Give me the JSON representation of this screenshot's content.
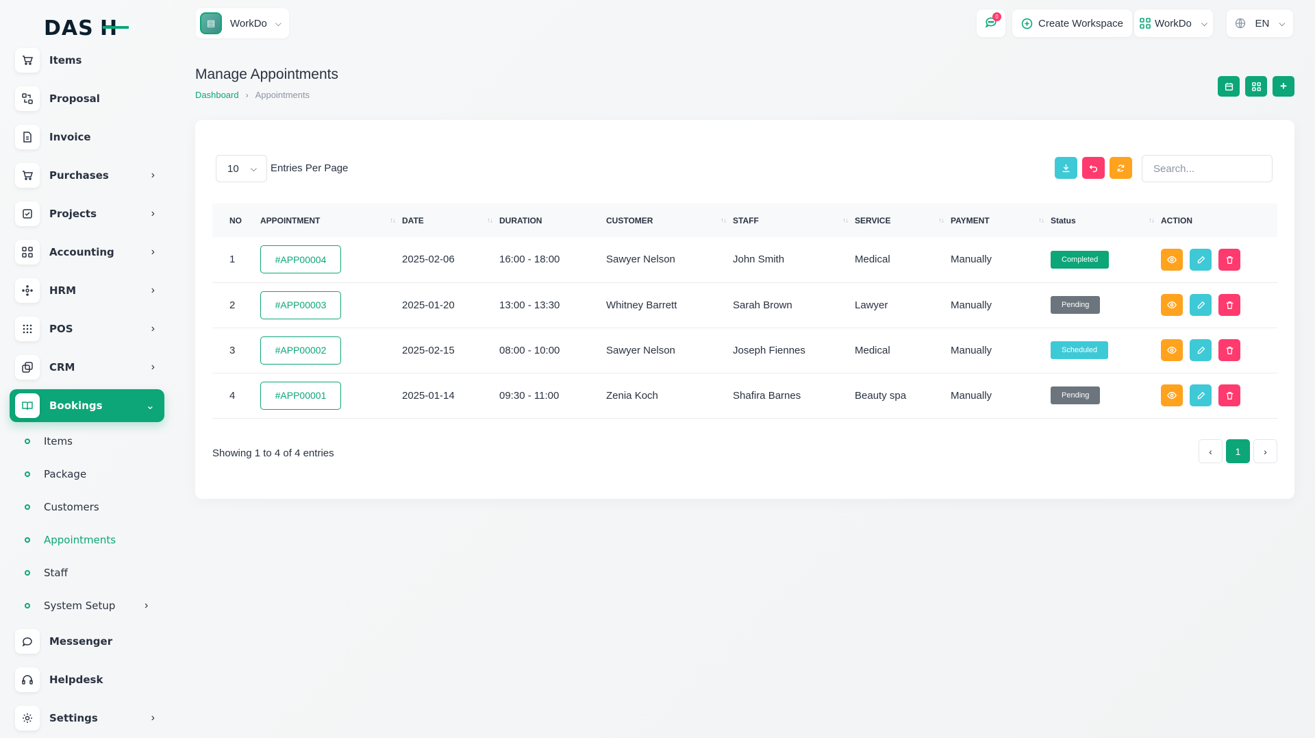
{
  "brand": {
    "logo_left": "DAS",
    "logo_right": "H"
  },
  "sidebar": {
    "items": [
      {
        "label": "Items",
        "icon": "cart-icon"
      },
      {
        "label": "Proposal",
        "icon": "proposal-icon"
      },
      {
        "label": "Invoice",
        "icon": "invoice-icon"
      },
      {
        "label": "Purchases",
        "icon": "cart-icon"
      },
      {
        "label": "Projects",
        "icon": "check-square-icon"
      },
      {
        "label": "Accounting",
        "icon": "grid-icon"
      },
      {
        "label": "HRM",
        "icon": "users-icon"
      },
      {
        "label": "POS",
        "icon": "dots-grid-icon"
      },
      {
        "label": "CRM",
        "icon": "layers-icon"
      },
      {
        "label": "Bookings",
        "icon": "book-icon"
      },
      {
        "label": "Messenger",
        "icon": "chat-icon"
      },
      {
        "label": "Helpdesk",
        "icon": "headset-icon"
      },
      {
        "label": "Settings",
        "icon": "gear-icon"
      }
    ],
    "bookings_sub": [
      {
        "label": "Items"
      },
      {
        "label": "Package"
      },
      {
        "label": "Customers"
      },
      {
        "label": "Appointments"
      },
      {
        "label": "Staff"
      },
      {
        "label": "System Setup"
      }
    ],
    "active_color": "#0ca678"
  },
  "header": {
    "workspace": "WorkDo",
    "messages_count": "0",
    "create_workspace": "Create Workspace",
    "workdo_menu": "WorkDo",
    "language": "EN"
  },
  "page": {
    "title": "Manage Appointments",
    "breadcrumb": {
      "home": "Dashboard",
      "current": "Appointments"
    }
  },
  "table": {
    "per_page": "10",
    "per_page_label": "Entries Per Page",
    "search_placeholder": "Search...",
    "headers": [
      "NO",
      "APPOINTMENT",
      "DATE",
      "DURATION",
      "CUSTOMER",
      "STAFF",
      "SERVICE",
      "PAYMENT",
      "Status",
      "ACTION"
    ],
    "rows": [
      {
        "no": "1",
        "appointment": "#APP00004",
        "date": "2025-02-06",
        "duration": "16:00 - 18:00",
        "customer": "Sawyer Nelson",
        "staff": "John Smith",
        "service": "Medical",
        "payment": "Manually",
        "status": "Completed",
        "status_color": "#0ca678"
      },
      {
        "no": "2",
        "appointment": "#APP00003",
        "date": "2025-01-20",
        "duration": "13:00 - 13:30",
        "customer": "Whitney Barrett",
        "staff": "Sarah Brown",
        "service": "Lawyer",
        "payment": "Manually",
        "status": "Pending",
        "status_color": "#6c757d"
      },
      {
        "no": "3",
        "appointment": "#APP00002",
        "date": "2025-02-15",
        "duration": "08:00 - 10:00",
        "customer": "Sawyer Nelson",
        "staff": "Joseph Fiennes",
        "service": "Medical",
        "payment": "Manually",
        "status": "Scheduled",
        "status_color": "#3ec9d6"
      },
      {
        "no": "4",
        "appointment": "#APP00001",
        "date": "2025-01-14",
        "duration": "09:30 - 11:00",
        "customer": "Zenia Koch",
        "staff": "Shafira Barnes",
        "service": "Beauty spa",
        "payment": "Manually",
        "status": "Pending",
        "status_color": "#6c757d"
      }
    ],
    "showing": "Showing 1 to 4 of 4 entries",
    "current_page": "1"
  },
  "colors": {
    "green": "#0ca678",
    "cyan": "#3ec9d6",
    "pink": "#ff3a6e",
    "orange": "#ffa21d"
  }
}
